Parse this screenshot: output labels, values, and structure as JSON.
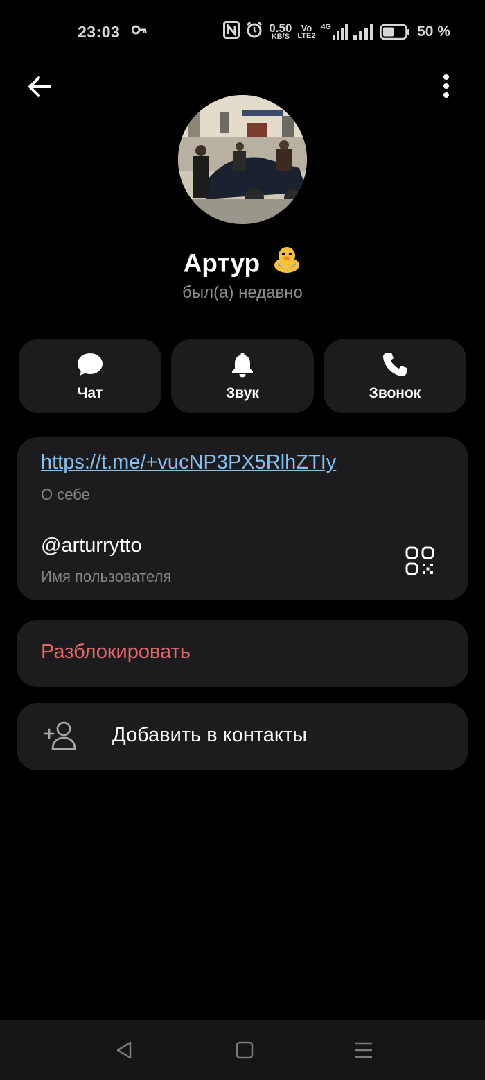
{
  "status_bar": {
    "time": "23:03",
    "speed_value": "0.50",
    "speed_unit": "KB/S",
    "volte_top": "Vo",
    "volte_bottom": "LTE2",
    "network": "4G",
    "battery": "50 %",
    "icons": [
      "key-icon",
      "nfc-icon",
      "alarm-icon",
      "signal-icon",
      "battery-icon"
    ]
  },
  "header": {
    "back_icon": "arrow-left-icon",
    "menu_icon": "more-vertical-icon"
  },
  "profile": {
    "name": "Артур",
    "emoji_icon": "duck-emoji-icon",
    "status": "был(а) недавно"
  },
  "actions": [
    {
      "label": "Чат",
      "icon": "chat-bubble-icon"
    },
    {
      "label": "Звук",
      "icon": "bell-icon"
    },
    {
      "label": "Звонок",
      "icon": "phone-icon"
    }
  ],
  "info": {
    "link": "https://t.me/+vucNP3PX5RlhZTIy",
    "link_caption": "О себе",
    "username": "@arturrytto",
    "username_caption": "Имя пользователя",
    "qr_icon": "qr-code-icon"
  },
  "unblock_label": "Разблокировать",
  "add_contact": {
    "label": "Добавить в контакты",
    "icon": "add-user-icon"
  },
  "colors": {
    "background": "#000000",
    "card": "#1c1c1e",
    "link": "#83c2f0",
    "danger": "#e8676b"
  },
  "nav": {
    "icons": [
      "back-triangle-icon",
      "home-square-icon",
      "recents-lines-icon"
    ]
  }
}
